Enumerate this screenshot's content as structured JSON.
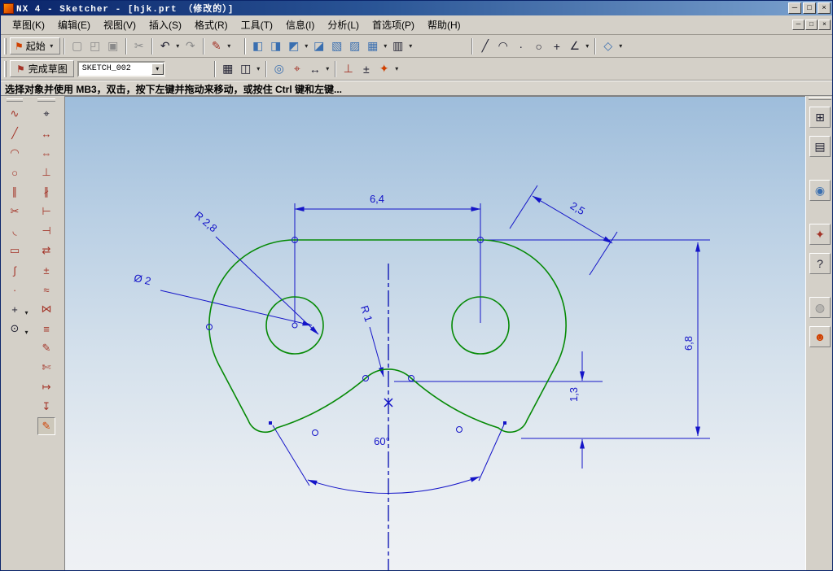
{
  "window": {
    "title": "NX 4 - Sketcher - [hjk.prt （修改的）]",
    "min": "─",
    "max": "□",
    "close": "×"
  },
  "menus": [
    "草图(K)",
    "编辑(E)",
    "视图(V)",
    "插入(S)",
    "格式(R)",
    "工具(T)",
    "信息(I)",
    "分析(L)",
    "首选项(P)",
    "帮助(H)"
  ],
  "toolbars": {
    "start_label": "起始",
    "finish_label": "完成草图",
    "sketch_name": "SKETCH_002"
  },
  "prompt": "选择对象并使用 MB3，双击，按下左键并拖动来移动，或按住 Ctrl 键和左键...",
  "dims": {
    "width": "6,4",
    "offset": "2,5",
    "corner_radius": "R 2,8",
    "hole_dia": "Ø 2",
    "notch_radius": "R 1",
    "height": "6,8",
    "depth": "1,3",
    "angle": "60°"
  },
  "colors": {
    "profile": "#068a06",
    "dimension": "#1414c8",
    "centerline": "#0008b0",
    "canvas_top": "#9ebddb",
    "canvas_bottom": "#eff1f4"
  },
  "glyphs": {
    "dd": "▾",
    "flag": "⚑",
    "new": "▢",
    "open": "◰",
    "save": "▣",
    "cut": "✂",
    "undo": "↶",
    "redo": "↷",
    "sketch": "✎",
    "cube_a": "◧",
    "cube_b": "◨",
    "cube_c": "◩",
    "cube_d": "◪",
    "cube_e": "▧",
    "cube_f": "▨",
    "cube_g": "▦",
    "display": "▥",
    "line": "╱",
    "arc": "◠",
    "point": "∙",
    "circle": "○",
    "plus": "+",
    "angle": "∠",
    "csys": "◇",
    "orient": "▦",
    "reattach": "◫",
    "zoom": "◎",
    "snap": "⌖",
    "dim": "↔",
    "perp": "⊥",
    "alt": "±",
    "update": "✦",
    "a_profile": "∿",
    "a_line": "╱",
    "a_arc": "◠",
    "a_circle": "○",
    "a_derived": "∥",
    "a_trim": "✂",
    "a_fillet": "◟",
    "a_rect": "▭",
    "a_spline": "∫",
    "a_point": "∙",
    "a_plus": "+",
    "a_conic": "⊙",
    "b_snap": "⌖",
    "b_dim": "↔",
    "b_autodim": "⇔",
    "b_constraint": "⊥",
    "b_show": "∦",
    "b_auto": "⊢",
    "b_noshow": "⊣",
    "b_convert": "⇄",
    "b_alt": "±",
    "b_infer": "≈",
    "b_mirror": "⋈",
    "b_offset": "≡",
    "b_edit": "✎",
    "b_trimrec": "✄",
    "b_extend": "↦",
    "b_project": "↧",
    "b_contdim": "✎",
    "n_assembly": "⊞",
    "n_part": "▤",
    "n_web": "◉",
    "n_vis": "✦",
    "n_help": "?",
    "n_history": "◍",
    "n_roles": "☻"
  }
}
